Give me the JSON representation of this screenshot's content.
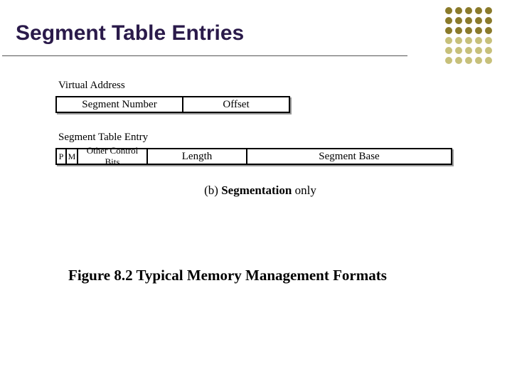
{
  "title": "Segment Table Entries",
  "figure": {
    "virtual_address": {
      "label": "Virtual Address",
      "fields": {
        "segment_number": "Segment Number",
        "offset": "Offset"
      }
    },
    "segment_table_entry": {
      "label": "Segment Table Entry",
      "fields": {
        "p": "P",
        "m": "M",
        "other_control_bits": "Other Control Bits",
        "length": "Length",
        "segment_base": "Segment Base"
      }
    },
    "subcaption": {
      "prefix": "(b) ",
      "bold": "Segmentation",
      "suffix": "  only"
    },
    "caption": {
      "bold": "Figure 8.2   Typical Memory Management Formats"
    }
  }
}
